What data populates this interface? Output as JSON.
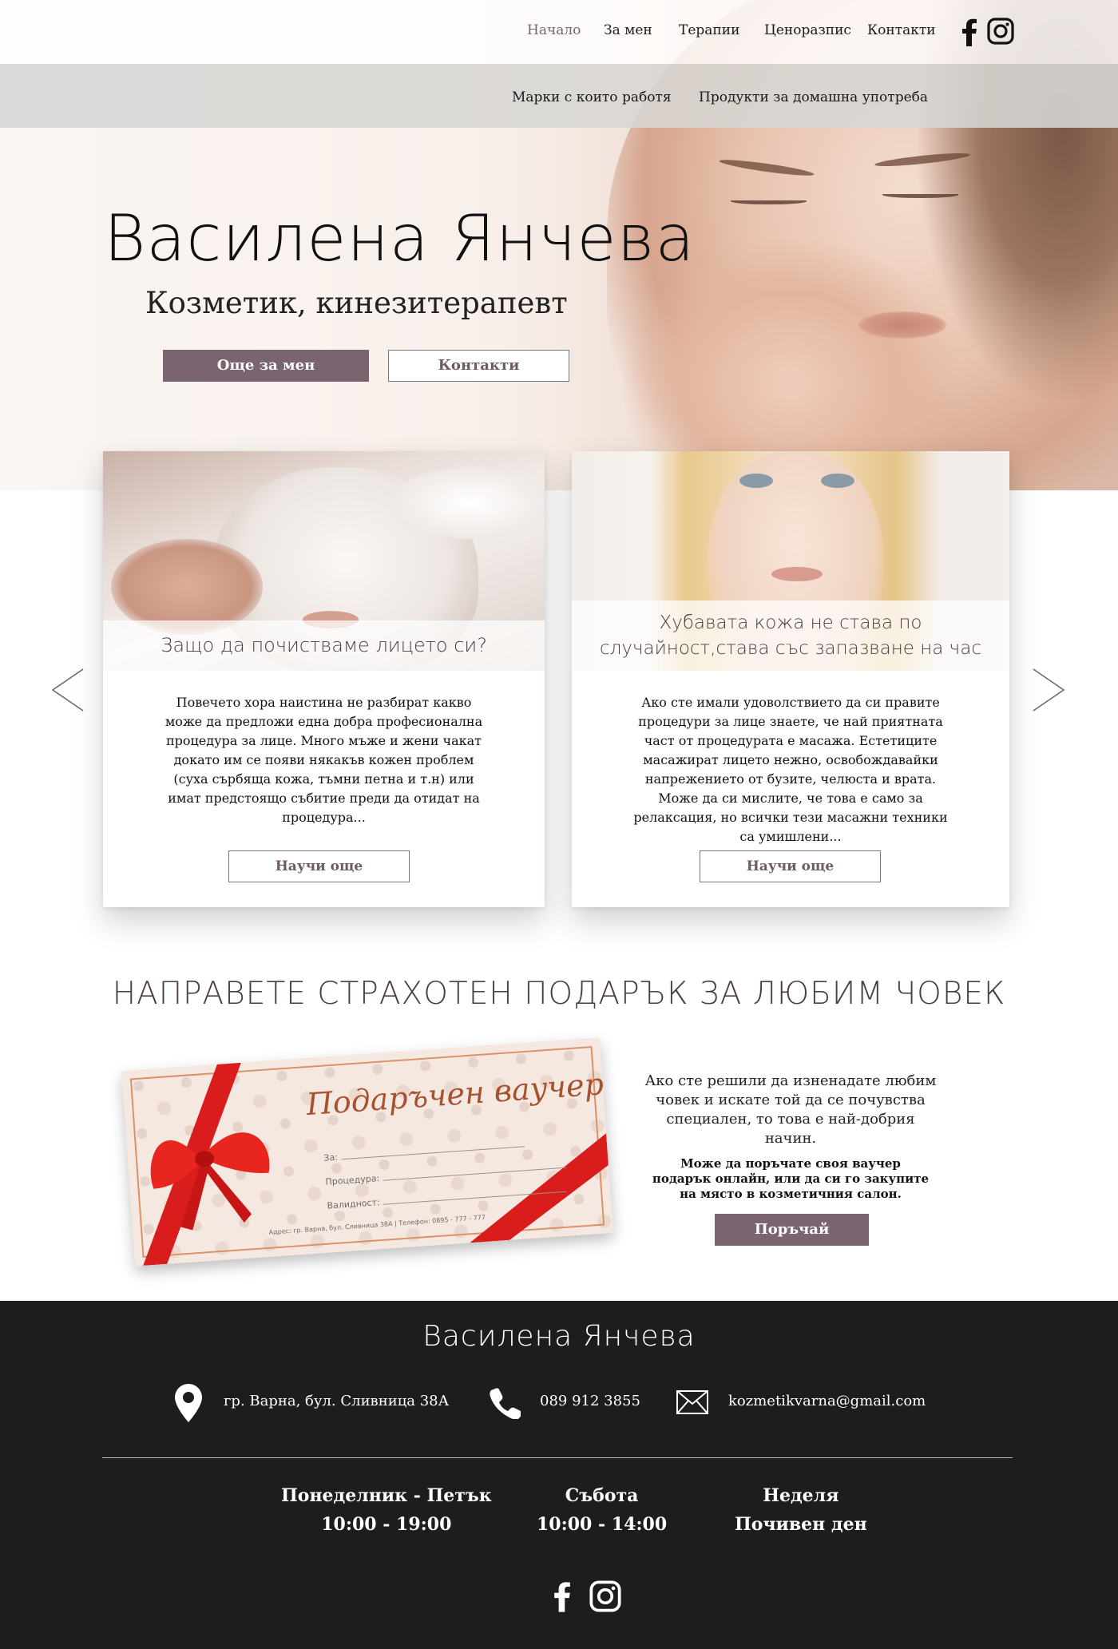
{
  "nav": {
    "items": [
      "Начало",
      "За мен",
      "Терапии",
      "Ценоразпис",
      "Контакти"
    ],
    "sub_items": [
      "Марки с които работя",
      "Продукти за домашна употреба"
    ],
    "social": [
      "facebook-icon",
      "instagram-icon"
    ]
  },
  "hero": {
    "title": "Василена Янчева",
    "subtitle": "Козметик, кинезитерапевт",
    "btn_about": "Още за мен",
    "btn_contacts": "Контакти"
  },
  "cards": [
    {
      "caption": "Защо да почистваме лицето си?",
      "text": "Повечето хора наистина не разбират какво може да предложи една добра професионална процедура за лице. Много мъже и жени чакат докато им се появи някакъв кожен проблем (суха сърбяща кожа, тъмни петна и т.н) или имат предстоящо събитие преди да отидат на процедура...",
      "button": "Научи още"
    },
    {
      "caption_line1": "Хубавата кожа не става по",
      "caption_line2": "случайност,става със запазване на час",
      "text": "Ако сте имали удоволствието да си правите процедури за лице знаете, че най приятната част от процедурата е масажа. Естетиците масажират лицето нежно, освобождавайки напрежението от бузите, челюста и врата. Може да си мислите, че това е само за релаксация, но всички тези масажни техники са умишлени...",
      "button": "Научи още"
    }
  ],
  "gift": {
    "title": "НАПРАВЕТЕ СТРАХОТЕН ПОДАРЪК ЗА ЛЮБИМ ЧОВЕК",
    "voucher_title": "Подаръчен ваучер",
    "voucher_for": "За:",
    "voucher_procedure": "Процедура:",
    "voucher_valid": "Валидност:",
    "voucher_address": "Адрес: гр. Варна, бул. Сливница 38А   |   Телефон: 0895 - 777 - 777",
    "text": "Ако сте решили да изненадате любим човек и искате той да се почувства специален, то това е най-добрия начин.",
    "bold_text": "Може да поръчате своя ваучер подарък онлайн, или да си го закупите на място в козметичния салон.",
    "order_button": "Поръчай"
  },
  "footer": {
    "name": "Василена Янчева",
    "address": "гр. Варна, бул. Сливница 38А",
    "phone": "089 912 3855",
    "email": "kozmetikvarna@gmail.com",
    "hours": [
      {
        "day": "Понеделник - Петък",
        "time": "10:00 - 19:00"
      },
      {
        "day": "Събота",
        "time": "10:00 - 14:00"
      },
      {
        "day": "Неделя",
        "time": "Почивен ден"
      }
    ]
  },
  "colors": {
    "accent": "#7a6470",
    "footer_bg": "#1d1d1d",
    "subnav_bg": "#d7d6d4"
  }
}
